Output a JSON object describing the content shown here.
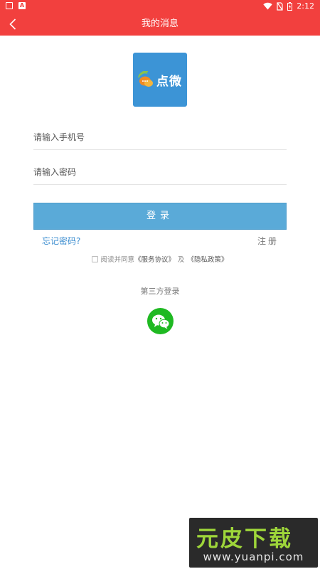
{
  "status_bar": {
    "time": "2:12"
  },
  "app_bar": {
    "title": "我的消息"
  },
  "logo": {
    "text": "点微"
  },
  "form": {
    "phone_placeholder": "请输入手机号",
    "password_placeholder": "请输入密码",
    "login_label": "登录",
    "forgot_label": "忘记密码?",
    "register_label": "注册"
  },
  "agreement": {
    "prefix": "阅读并同意",
    "service_link": "《服务协议》",
    "and": "及",
    "privacy_link": "《隐私政策》"
  },
  "third_party": {
    "label": "第三方登录"
  },
  "watermark": {
    "title": "元皮下载",
    "url": "www.yuanpi.com"
  },
  "colors": {
    "primary": "#f2403e",
    "login_button": "#5aaad8",
    "link": "#3a8ccf",
    "logo_bg": "#3c94d6",
    "wechat": "#1fb922"
  }
}
